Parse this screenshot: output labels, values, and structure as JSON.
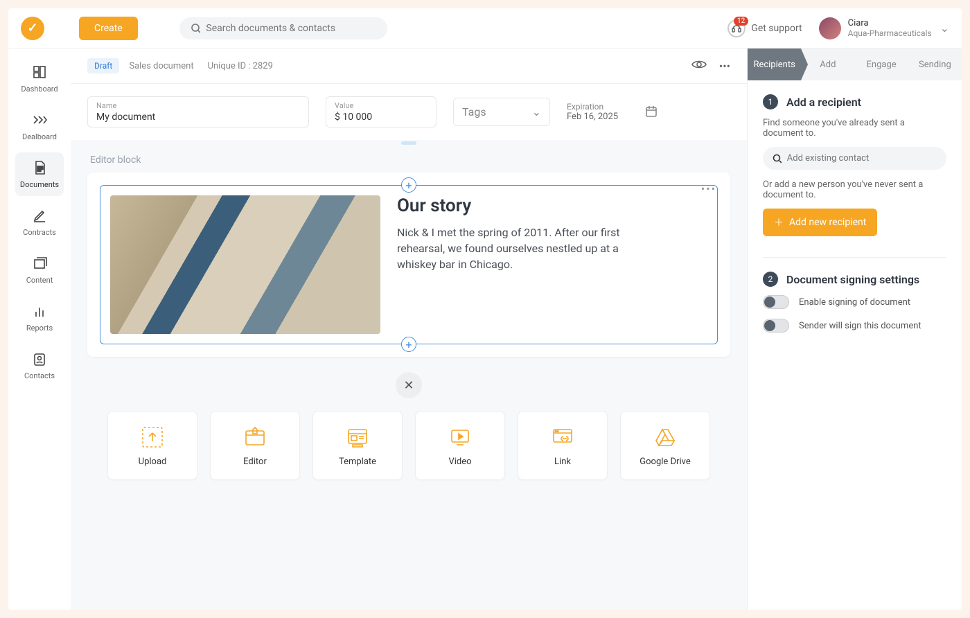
{
  "header": {
    "create_label": "Create",
    "search_placeholder": "Search documents & contacts",
    "support_label": "Get support",
    "support_badge": "12",
    "user_name": "Ciara",
    "user_org": "Aqua-Pharmaceuticals"
  },
  "leftnav": [
    {
      "label": "Dashboard"
    },
    {
      "label": "Dealboard"
    },
    {
      "label": "Documents"
    },
    {
      "label": "Contracts"
    },
    {
      "label": "Content"
    },
    {
      "label": "Reports"
    },
    {
      "label": "Contacts"
    }
  ],
  "doc": {
    "status_chip": "Draft",
    "type_label": "Sales document",
    "unique_id_label": "Unique ID : 2829",
    "name_label": "Name",
    "name_value": "My document",
    "value_label": "Value",
    "value_value": "$   10 000",
    "tags_label": "Tags",
    "expiration_label": "Expiration",
    "expiration_value": "Feb 16, 2025"
  },
  "editor": {
    "block_label": "Editor block",
    "story_title": "Our story",
    "story_body": "Nick & I met the spring of 2011. After our first rehearsal, we found ourselves nestled up at a whiskey bar in Chicago."
  },
  "tiles": [
    {
      "label": "Upload"
    },
    {
      "label": "Editor"
    },
    {
      "label": "Template"
    },
    {
      "label": "Video"
    },
    {
      "label": "Link"
    },
    {
      "label": "Google Drive"
    }
  ],
  "right": {
    "steps": [
      "Recipients",
      "Add",
      "Engage",
      "Sending"
    ],
    "s1_num": "1",
    "s1_title": "Add a recipient",
    "s1_sub": "Find someone you've already sent a document to.",
    "s1_search_placeholder": "Add existing contact",
    "s1_or": "Or add a new person you've never sent a document to.",
    "s1_add_btn": "Add new recipient",
    "s2_num": "2",
    "s2_title": "Document signing settings",
    "toggle1": "Enable signing of document",
    "toggle2": "Sender will sign this document"
  }
}
